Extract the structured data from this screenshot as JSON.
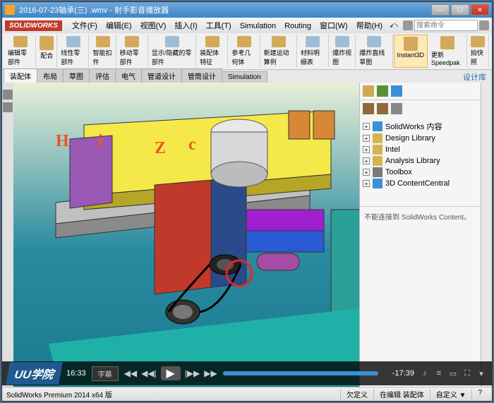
{
  "titlebar": {
    "title": "2016-07-23轴承(三) .wmv - 射手影音播放器"
  },
  "menu": {
    "logo": "SOLIDWORKS",
    "items": [
      "文件(F)",
      "编辑(E)",
      "视图(V)",
      "插入(I)",
      "工具(T)",
      "Simulation",
      "Routing",
      "窗口(W)",
      "帮助(H)"
    ],
    "search_placeholder": "搜索命令"
  },
  "ribbon": {
    "groups": [
      "编辑零部件",
      "配合",
      "线性零部件",
      "智能扣件",
      "移动零部件",
      "显示/隐藏的零部件",
      "装配体特征",
      "参考几何体",
      "新建运动算例",
      "材料明细表",
      "爆炸视图",
      "爆炸直线草图",
      "Instant3D",
      "更新Speedpak",
      "拍快照"
    ],
    "selected_index": 12
  },
  "tabs": {
    "items": [
      "装配体",
      "布局",
      "草图",
      "评估",
      "电气",
      "管道设计",
      "管筒设计",
      "Simulation"
    ],
    "active_index": 0,
    "right_label": "设计库"
  },
  "tree": {
    "items": [
      {
        "icon": "globe",
        "label": "SolidWorks 内容"
      },
      {
        "icon": "folder",
        "label": "Design Library"
      },
      {
        "icon": "folder",
        "label": "Intel"
      },
      {
        "icon": "folder",
        "label": "Analysis Library"
      },
      {
        "icon": "bolt",
        "label": "Toolbox"
      },
      {
        "icon": "globe",
        "label": "3D ContentCentral"
      }
    ],
    "message": "不能连接到 SolidWorks Content。"
  },
  "player": {
    "brand": "UU学院",
    "time_left": "16:33",
    "subtitle_btn": "字幕",
    "time_right": "-17:39"
  },
  "statusbar": {
    "product": "SolidWorks Premium 2014 x64 版",
    "items": [
      "欠定义",
      "在编辑 装配体",
      "自定义 ▼",
      "?"
    ]
  }
}
